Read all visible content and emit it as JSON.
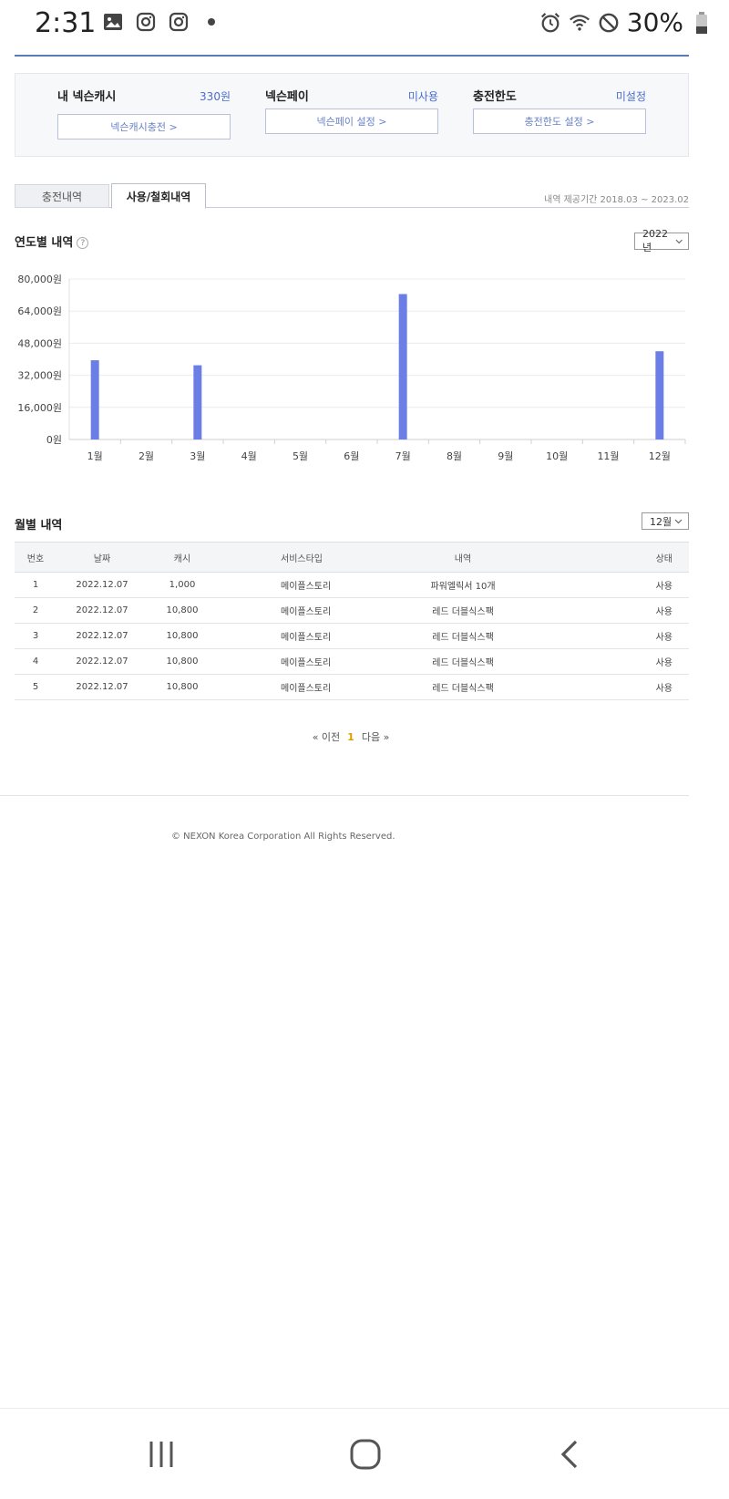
{
  "status_bar": {
    "time": "2:31",
    "battery_pct": "30%",
    "icons_left": [
      "gallery-icon",
      "instagram-icon",
      "instagram-icon",
      "dot-icon"
    ],
    "icons_right": [
      "alarm-icon",
      "wifi-icon",
      "do-not-disturb-icon",
      "battery-icon"
    ]
  },
  "summary": {
    "cash": {
      "label": "내 넥슨캐시",
      "value": "330원",
      "button": "넥슨캐시충전 >"
    },
    "pay": {
      "label": "넥슨페이",
      "value": "미사용",
      "button": "넥슨페이 설정 >"
    },
    "limit": {
      "label": "충전한도",
      "value": "미설정",
      "button": "충전한도 설정 >"
    }
  },
  "tabs": {
    "charge": "충전내역",
    "use": "사용/철회내역",
    "period": "내역 제공기간 2018.03 ~ 2023.02"
  },
  "yearly": {
    "title": "연도별 내역",
    "year_select": "2022년"
  },
  "chart_data": {
    "type": "bar",
    "categories": [
      "1월",
      "2월",
      "3월",
      "4월",
      "5월",
      "6월",
      "7월",
      "8월",
      "9월",
      "10월",
      "11월",
      "12월"
    ],
    "values": [
      39500,
      0,
      37000,
      0,
      0,
      0,
      72500,
      0,
      0,
      0,
      0,
      44000
    ],
    "y_ticks": [
      "0원",
      "16,000원",
      "32,000원",
      "48,000원",
      "64,000원",
      "80,000원"
    ],
    "ylim": [
      0,
      80000
    ],
    "bar_color": "#6b7ee6",
    "grid": true
  },
  "monthly": {
    "title": "월별 내역",
    "month_select": "12월",
    "columns": [
      "번호",
      "날짜",
      "캐시",
      "서비스타입",
      "내역",
      "상태"
    ],
    "rows": [
      [
        "1",
        "2022.12.07",
        "1,000",
        "메이플스토리",
        "파워엘릭서 10개",
        "사용"
      ],
      [
        "2",
        "2022.12.07",
        "10,800",
        "메이플스토리",
        "레드 더블식스팩",
        "사용"
      ],
      [
        "3",
        "2022.12.07",
        "10,800",
        "메이플스토리",
        "레드 더블식스팩",
        "사용"
      ],
      [
        "4",
        "2022.12.07",
        "10,800",
        "메이플스토리",
        "레드 더블식스팩",
        "사용"
      ],
      [
        "5",
        "2022.12.07",
        "10,800",
        "메이플스토리",
        "레드 더블식스팩",
        "사용"
      ]
    ]
  },
  "pager": {
    "prev": "« 이전",
    "current": "1",
    "next": "다음 »"
  },
  "footer": "© NEXON Korea Corporation All Rights Reserved.",
  "colors": {
    "accent": "#4b6cd1",
    "bar": "#6b7ee6",
    "pager_current": "#d9a000"
  }
}
